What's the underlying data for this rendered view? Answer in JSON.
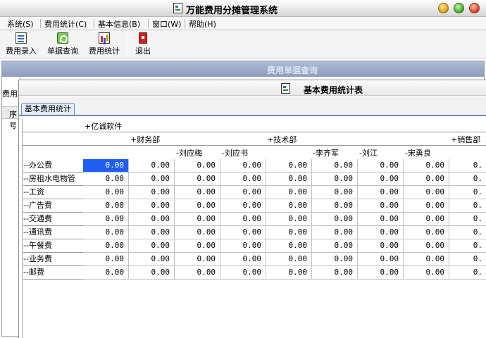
{
  "window": {
    "title": "万能费用分摊管理系统"
  },
  "menu": [
    {
      "label": "系统(S)"
    },
    {
      "label": "费用统计(C)"
    },
    {
      "label": "基本信息(B)"
    },
    {
      "label": "窗口(W)"
    },
    {
      "label": "帮助(H)"
    }
  ],
  "toolbar": [
    {
      "label": "费用录入",
      "icon": "entry-icon"
    },
    {
      "label": "单据查询",
      "icon": "query-icon"
    },
    {
      "label": "费用统计",
      "icon": "stats-icon"
    },
    {
      "label": "退出",
      "icon": "exit-icon"
    }
  ],
  "background_window": {
    "title": "费用单据查询",
    "side_label": "费用单",
    "column_label": "序号"
  },
  "report_window": {
    "title": "基本费用统计表",
    "tab": "基本费用统计"
  },
  "grid": {
    "company": "+亿诚软件",
    "departments": [
      "+财务部",
      "+技术部",
      "+销售部"
    ],
    "people": [
      "-刘应梅",
      "-刘应书",
      "-李齐军",
      "-刘江",
      "-宋勇良"
    ],
    "rows": [
      {
        "label": "--办公费",
        "values": [
          "0.00",
          "0.00",
          "0.00",
          "0.00",
          "0.00",
          "0.00",
          "0.00",
          "0.00",
          "0."
        ]
      },
      {
        "label": "--房租水电物管",
        "values": [
          "0.00",
          "0.00",
          "0.00",
          "0.00",
          "0.00",
          "0.00",
          "0.00",
          "0.00",
          "0."
        ]
      },
      {
        "label": "--工资",
        "values": [
          "0.00",
          "0.00",
          "0.00",
          "0.00",
          "0.00",
          "0.00",
          "0.00",
          "0.00",
          "0."
        ]
      },
      {
        "label": "--广告费",
        "values": [
          "0.00",
          "0.00",
          "0.00",
          "0.00",
          "0.00",
          "0.00",
          "0.00",
          "0.00",
          "0."
        ]
      },
      {
        "label": "--交通费",
        "values": [
          "0.00",
          "0.00",
          "0.00",
          "0.00",
          "0.00",
          "0.00",
          "0.00",
          "0.00",
          "0."
        ]
      },
      {
        "label": "--通讯费",
        "values": [
          "0.00",
          "0.00",
          "0.00",
          "0.00",
          "0.00",
          "0.00",
          "0.00",
          "0.00",
          "0."
        ]
      },
      {
        "label": "--午餐费",
        "values": [
          "0.00",
          "0.00",
          "0.00",
          "0.00",
          "0.00",
          "0.00",
          "0.00",
          "0.00",
          "0."
        ]
      },
      {
        "label": "--业务费",
        "values": [
          "0.00",
          "0.00",
          "0.00",
          "0.00",
          "0.00",
          "0.00",
          "0.00",
          "0.00",
          "0."
        ]
      },
      {
        "label": "--邮费",
        "values": [
          "0.00",
          "0.00",
          "0.00",
          "0.00",
          "0.00",
          "0.00",
          "0.00",
          "0.00",
          "0."
        ]
      }
    ]
  },
  "colors": {
    "selection": "#1f5ff0",
    "tab_border": "#6f87b8",
    "background_title": "#8d9dbd"
  }
}
